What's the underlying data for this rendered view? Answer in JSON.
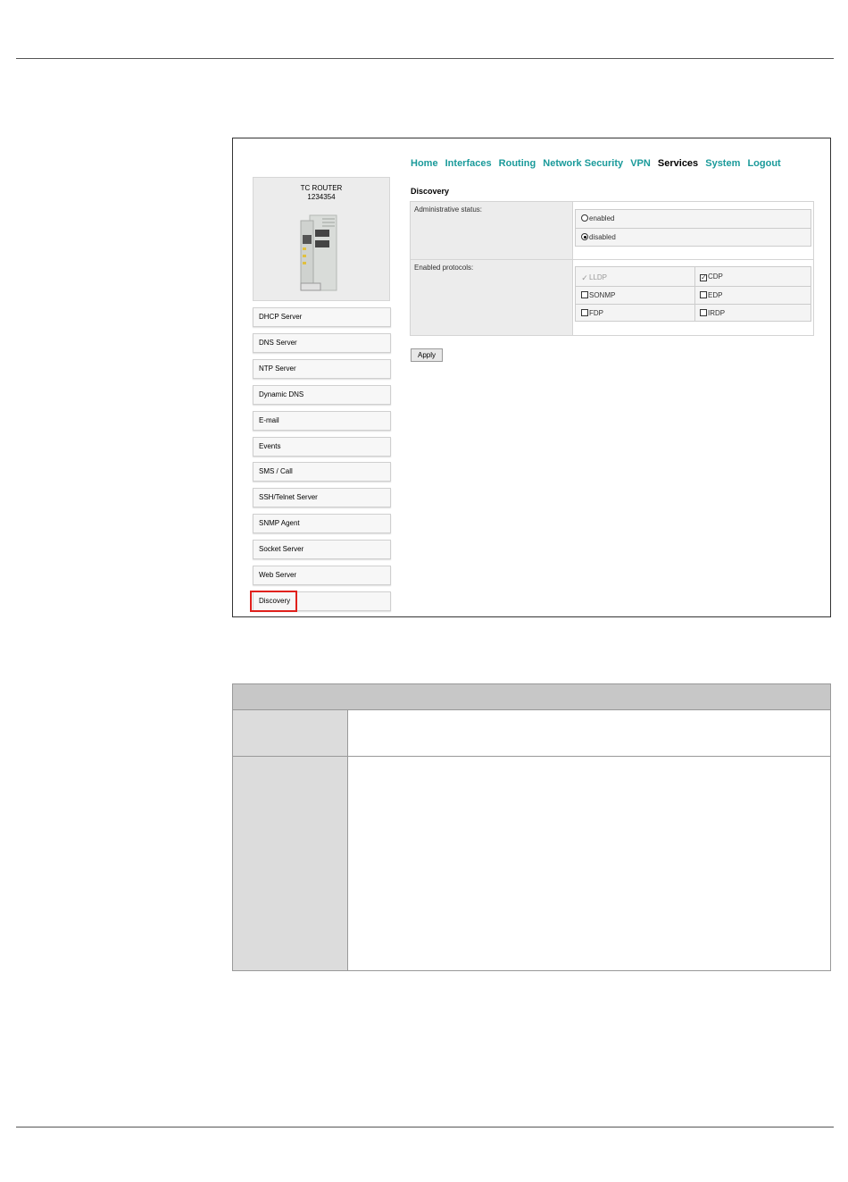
{
  "router": {
    "nav": [
      "Home",
      "Interfaces",
      "Routing",
      "Network Security",
      "VPN",
      "Services",
      "System",
      "Logout"
    ],
    "active_nav": "Services",
    "device": {
      "name": "TC ROUTER",
      "serial": "1234354"
    },
    "sidebar": [
      "DHCP Server",
      "DNS Server",
      "NTP Server",
      "Dynamic DNS",
      "E-mail",
      "Events",
      "SMS / Call",
      "SSH/Telnet Server",
      "SNMP Agent",
      "Socket Server",
      "Web Server",
      "Discovery"
    ],
    "highlighted_item": "Discovery",
    "page_title": "Discovery",
    "admin_status_label": "Administrative status:",
    "admin_options": [
      {
        "label": "enabled",
        "selected": false
      },
      {
        "label": "disabled",
        "selected": true
      }
    ],
    "protocols_label": "Enabled protocols:",
    "protocols": [
      {
        "label": "LLDP",
        "checked": true,
        "disabled": true
      },
      {
        "label": "CDP",
        "checked": true,
        "disabled": false
      },
      {
        "label": "SONMP",
        "checked": false,
        "disabled": false
      },
      {
        "label": "EDP",
        "checked": false,
        "disabled": false
      },
      {
        "label": "FDP",
        "checked": false,
        "disabled": false
      },
      {
        "label": "IRDP",
        "checked": false,
        "disabled": false
      }
    ],
    "apply_label": "Apply"
  },
  "colors": {
    "link": "#1a9a9a",
    "highlight": "#e0201c",
    "table_header": "#c7c7c7",
    "table_label": "#dcdcdc"
  }
}
